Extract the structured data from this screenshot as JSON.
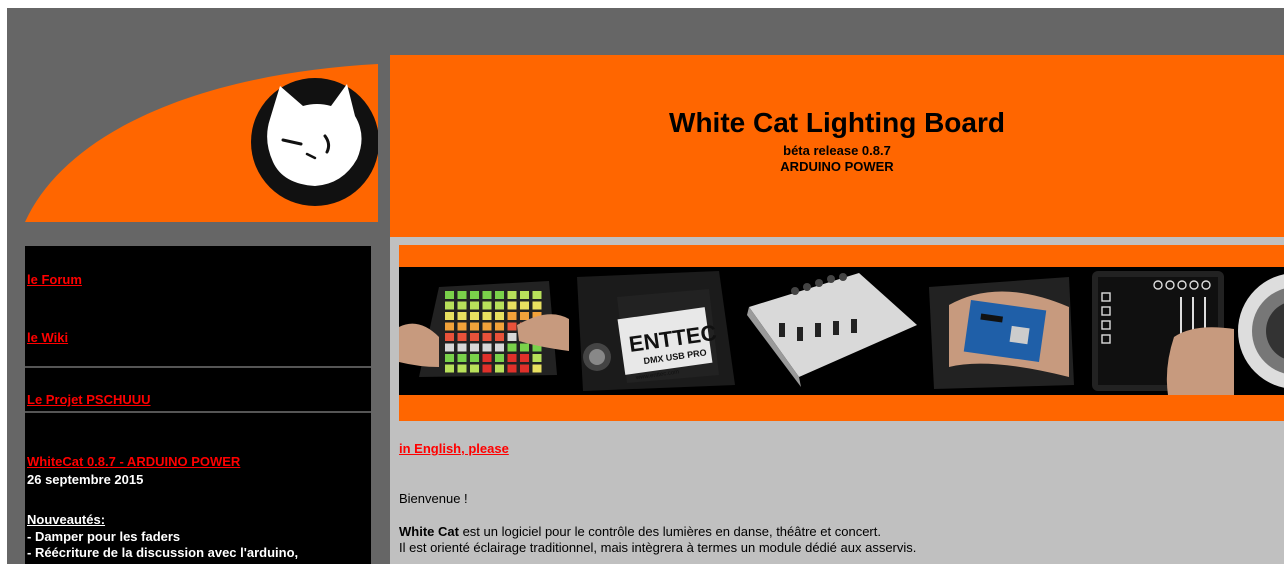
{
  "header": {
    "title": "White Cat Lighting Board",
    "subtitle": "béta release 0.8.7",
    "subtitle2": "ARDUINO POWER"
  },
  "sidebar": {
    "forum": "le Forum",
    "wiki": "le Wiki",
    "projet": "Le Projet PSCHUUU",
    "release_link": "WhiteCat  0.8.7 -  ARDUINO POWER",
    "release_date": "26 septembre 2015",
    "news_heading": "Nouveautés:",
    "news_1": "- Damper pour les faders",
    "news_2": "- Réécriture de la discussion avec l'arduino,"
  },
  "banner": {
    "enttec_brand": "ENTTEC",
    "enttec_model": "DMX USB PRO",
    "enttec_url": "www.enttec.com"
  },
  "main": {
    "english_link": "in English, please",
    "welcome": "Bienvenue !",
    "intro_bold": "White Cat",
    "intro_rest": " est un logiciel pour le contrôle des lumières en danse, théâtre et concert.",
    "intro_line2": "Il est orienté éclairage traditionnel, mais intègrera à termes un module dédié aux asservis."
  },
  "colors": {
    "accent": "#ff6600",
    "frame": "#666666",
    "link": "#ff0000",
    "sidebar_bg": "#000000",
    "content_bg": "#c0c0c0"
  }
}
